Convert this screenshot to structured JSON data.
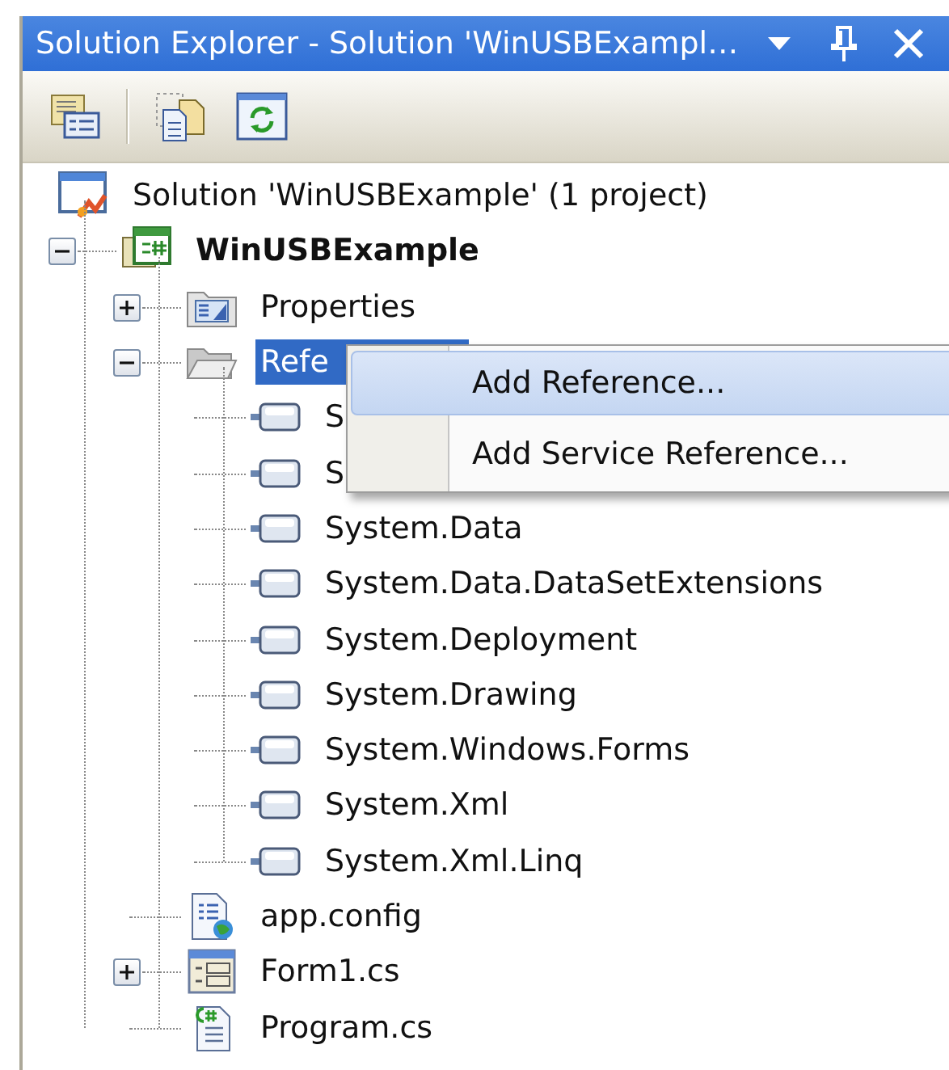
{
  "window": {
    "title": "Solution Explorer - Solution 'WinUSBExampl…",
    "buttons": [
      {
        "kind": "dropdown"
      },
      {
        "kind": "pin"
      },
      {
        "kind": "close"
      }
    ]
  },
  "toolbar": [
    {
      "kind": "properties"
    },
    {
      "kind": "separator"
    },
    {
      "kind": "show-all"
    },
    {
      "kind": "refresh"
    }
  ],
  "tree": [
    {
      "label": "Solution 'WinUSBExample' (1 project)",
      "kind": "solution",
      "selected": false,
      "children": [
        {
          "label": "WinUSBExample",
          "kind": "csproj",
          "bold": true,
          "expanded": true,
          "selected": false,
          "children": [
            {
              "label": "Properties",
              "kind": "properties",
              "expanded": false,
              "selected": false
            },
            {
              "label": "Refe",
              "kind": "folder",
              "expanded": true,
              "selected": true,
              "children": [
                {
                  "label": "S",
                  "kind": "reference",
                  "selected": false
                },
                {
                  "label": "S",
                  "kind": "reference",
                  "selected": false
                },
                {
                  "label": "System.Data",
                  "kind": "reference",
                  "selected": false
                },
                {
                  "label": "System.Data.DataSetExtensions",
                  "kind": "reference",
                  "selected": false
                },
                {
                  "label": "System.Deployment",
                  "kind": "reference",
                  "selected": false
                },
                {
                  "label": "System.Drawing",
                  "kind": "reference",
                  "selected": false
                },
                {
                  "label": "System.Windows.Forms",
                  "kind": "reference",
                  "selected": false
                },
                {
                  "label": "System.Xml",
                  "kind": "reference",
                  "selected": false
                },
                {
                  "label": "System.Xml.Linq",
                  "kind": "reference",
                  "selected": false
                }
              ]
            },
            {
              "label": "app.config",
              "kind": "config",
              "selected": false
            },
            {
              "label": "Form1.cs",
              "kind": "form",
              "expanded": false,
              "selected": false
            },
            {
              "label": "Program.cs",
              "kind": "csfile",
              "selected": false
            }
          ]
        }
      ]
    }
  ],
  "context_menu": {
    "items": [
      {
        "label": "Add Reference...",
        "selected": true
      },
      {
        "label": "Add Service Reference...",
        "selected": false
      }
    ]
  }
}
